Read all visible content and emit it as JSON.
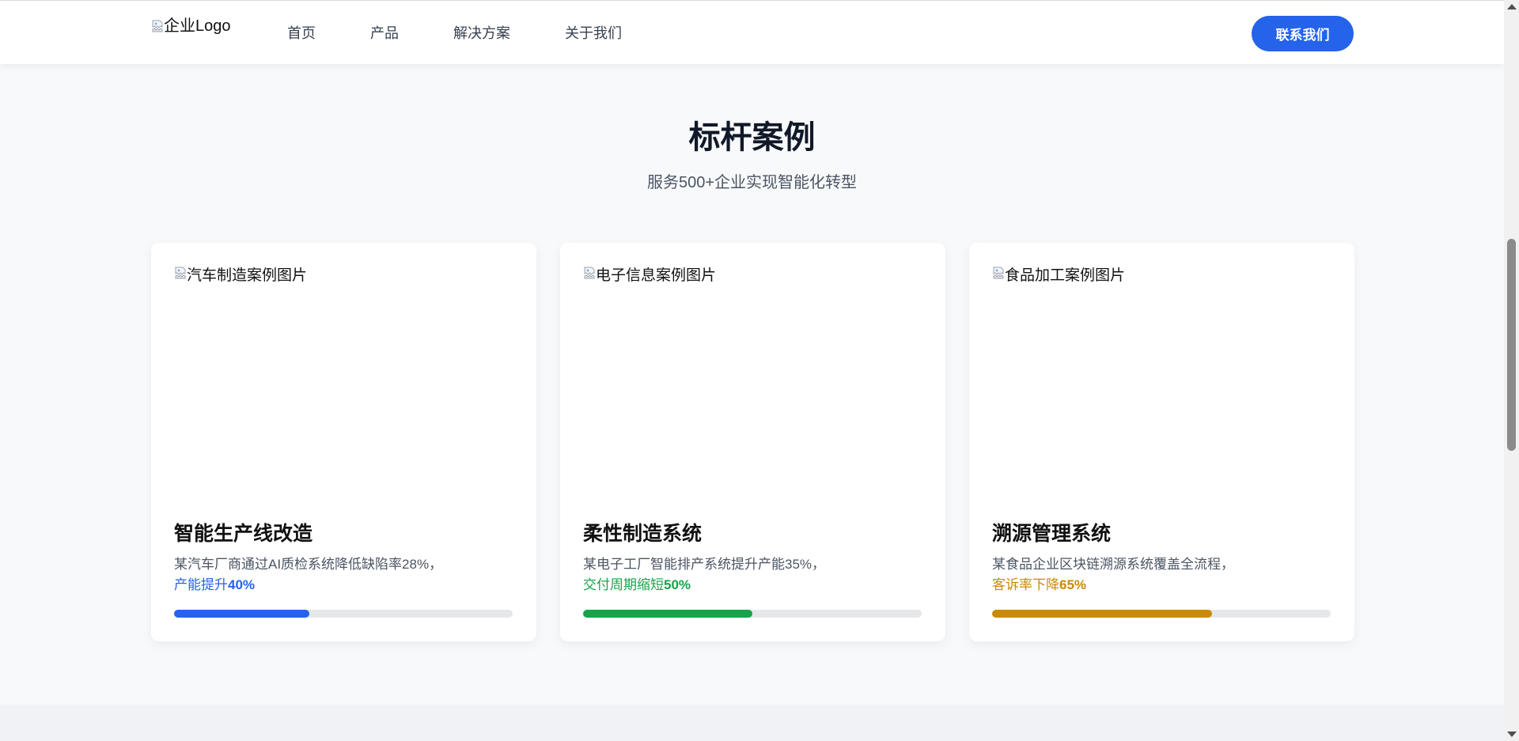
{
  "header": {
    "logo_alt": "企业Logo",
    "nav": [
      {
        "label": "首页"
      },
      {
        "label": "产品"
      },
      {
        "label": "解决方案"
      },
      {
        "label": "关于我们"
      }
    ],
    "contact_label": "联系我们"
  },
  "section": {
    "title": "标杆案例",
    "subtitle": "服务500+企业实现智能化转型"
  },
  "cards": [
    {
      "image_alt": "汽车制造案例图片",
      "title": "智能生产线改造",
      "description": "某汽车厂商通过AI质检系统降低缺陷率28%，",
      "highlight_prefix": "产能提升",
      "highlight_value": "40%",
      "progress": 0.4,
      "color": "#2563eb"
    },
    {
      "image_alt": "电子信息案例图片",
      "title": "柔性制造系统",
      "description": "某电子工厂智能排产系统提升产能35%，",
      "highlight_prefix": "交付周期缩短",
      "highlight_value": "50%",
      "progress": 0.5,
      "color": "#16a34a"
    },
    {
      "image_alt": "食品加工案例图片",
      "title": "溯源管理系统",
      "description": "某食品企业区块链溯源系统覆盖全流程，",
      "highlight_prefix": "客诉率下降",
      "highlight_value": "65%",
      "progress": 0.65,
      "color": "#ca8a04"
    }
  ],
  "icons": {
    "broken_image": "broken-image-icon",
    "scroll_up": "chevron-up-icon",
    "scroll_down": "chevron-down-icon"
  }
}
